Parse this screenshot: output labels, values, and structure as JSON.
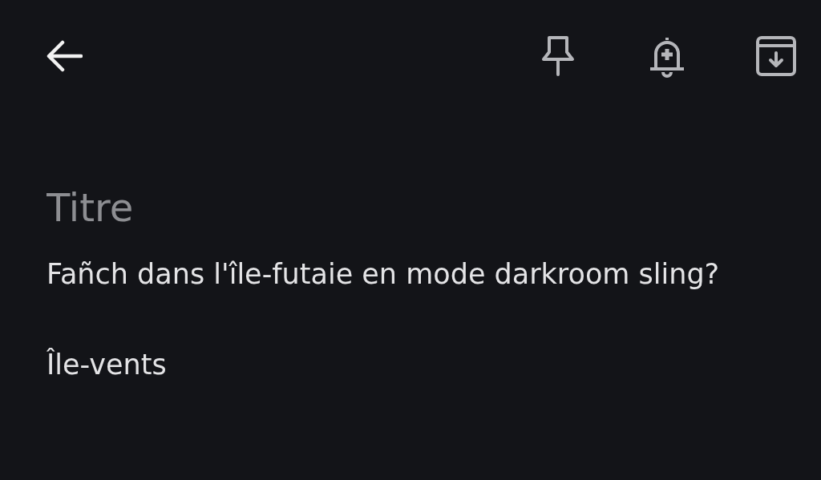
{
  "toolbar": {
    "actions": [
      {
        "kind": "pin"
      },
      {
        "kind": "reminder"
      },
      {
        "kind": "archive"
      }
    ]
  },
  "note": {
    "title": {
      "placeholder": "Titre"
    },
    "paragraphs": [
      "Fañch dans l'île-futaie en mode darkroom sling?",
      "Île-vents"
    ]
  }
}
